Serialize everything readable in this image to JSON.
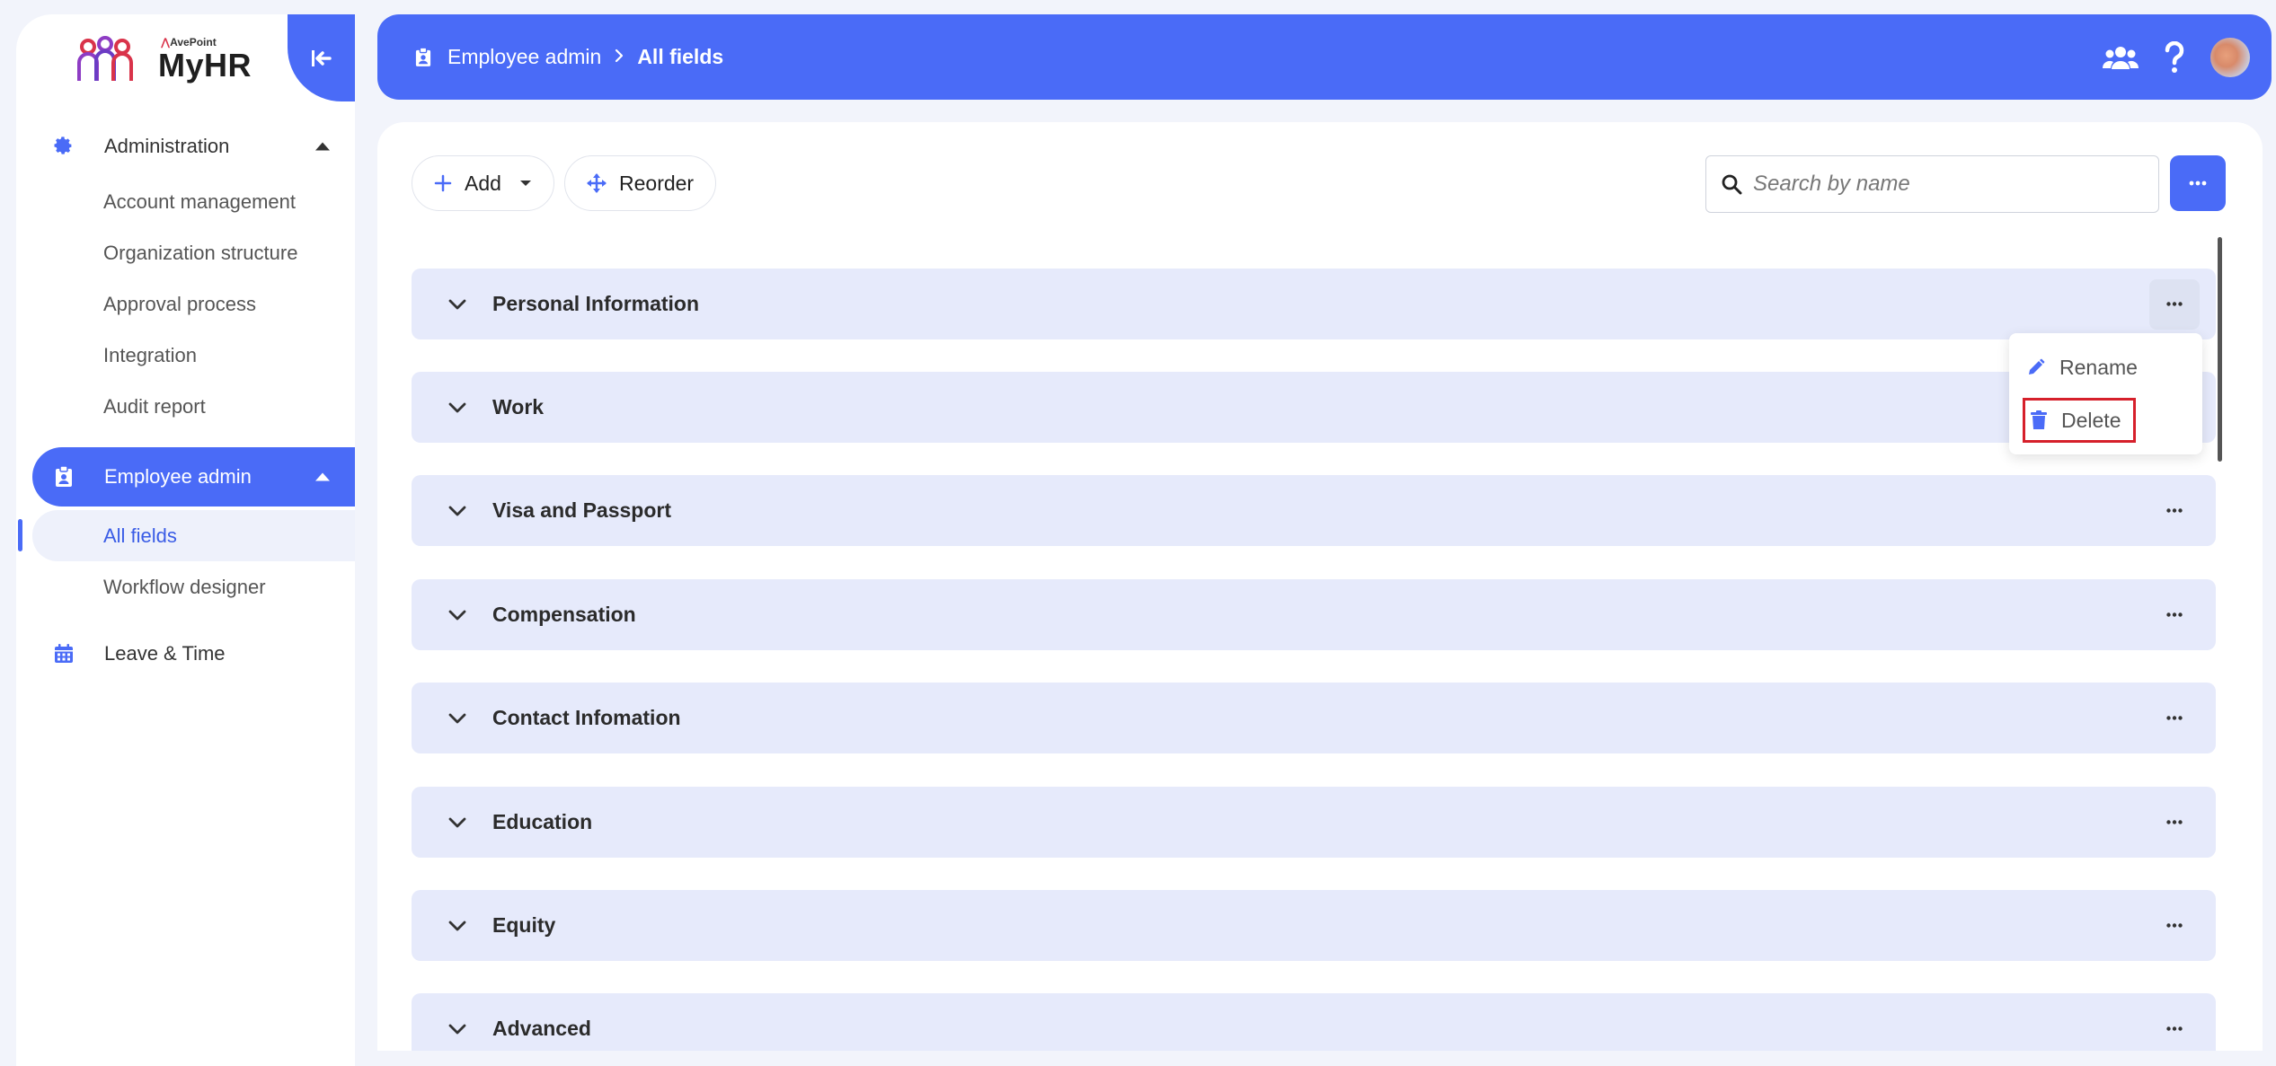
{
  "app": {
    "logo_company": "AvePoint",
    "logo_name": "MyHR"
  },
  "sidebar": {
    "groups": [
      {
        "label": "Administration",
        "icon": "gear-icon",
        "items": [
          "Account management",
          "Organization structure",
          "Approval process",
          "Integration",
          "Audit report"
        ]
      },
      {
        "label": "Employee admin",
        "icon": "badge-icon",
        "active": true,
        "items": [
          "All fields",
          "Workflow designer"
        ]
      },
      {
        "label": "Leave & Time",
        "icon": "calendar-icon",
        "items": []
      }
    ]
  },
  "header": {
    "breadcrumb": {
      "parent": "Employee admin",
      "current": "All fields"
    },
    "icons": [
      "people-icon",
      "help-icon",
      "avatar"
    ]
  },
  "toolbar": {
    "add_label": "Add",
    "reorder_label": "Reorder",
    "search_placeholder": "Search by name"
  },
  "sections": [
    "Personal Information",
    "Work",
    "Visa and Passport",
    "Compensation",
    "Contact Infomation",
    "Education",
    "Equity",
    "Advanced"
  ],
  "context_menu": {
    "rename_label": "Rename",
    "delete_label": "Delete"
  },
  "colors": {
    "primary": "#4a6bf7",
    "section_bg": "#e6eafb",
    "highlight": "#d6202b"
  }
}
